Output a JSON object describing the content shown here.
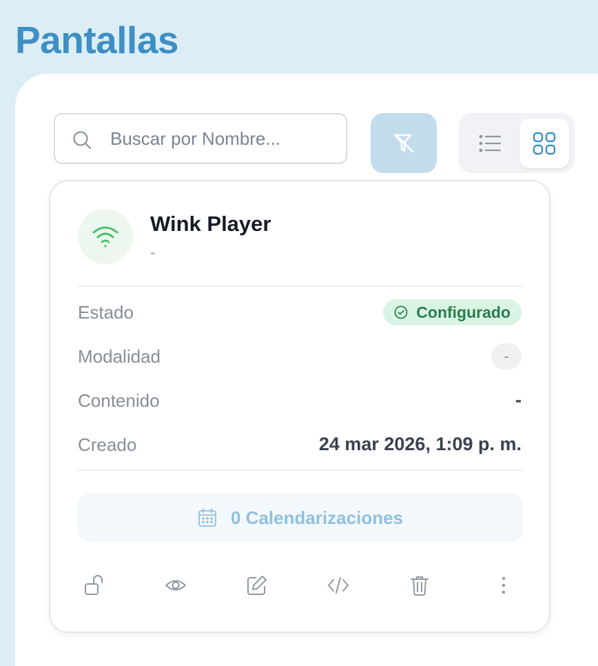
{
  "page": {
    "title": "Pantallas"
  },
  "search": {
    "placeholder": "Buscar por Nombre...",
    "value": ""
  },
  "toolbar": {
    "filter_icon": "filter-off-icon",
    "view_list_icon": "list-icon",
    "view_grid_icon": "grid-icon",
    "active_view": "grid"
  },
  "card": {
    "title": "Wink Player",
    "subtitle": "-",
    "status_icon": "wifi-icon",
    "rows": {
      "estado": {
        "label": "Estado",
        "value": "Configurado"
      },
      "modalidad": {
        "label": "Modalidad",
        "value": "-"
      },
      "contenido": {
        "label": "Contenido",
        "value": "-"
      },
      "creado": {
        "label": "Creado",
        "value": "24 mar 2026, 1:09 p. m."
      }
    },
    "schedules_label": "0 Calendarizaciones",
    "actions": [
      "unlock-icon",
      "eye-icon",
      "edit-icon",
      "code-icon",
      "trash-icon",
      "more-vertical-icon"
    ]
  },
  "colors": {
    "accent": "#3d8fc4",
    "success_bg": "#d9f4e3",
    "success_text": "#2a7d4f",
    "wifi": "#4cc26a"
  }
}
